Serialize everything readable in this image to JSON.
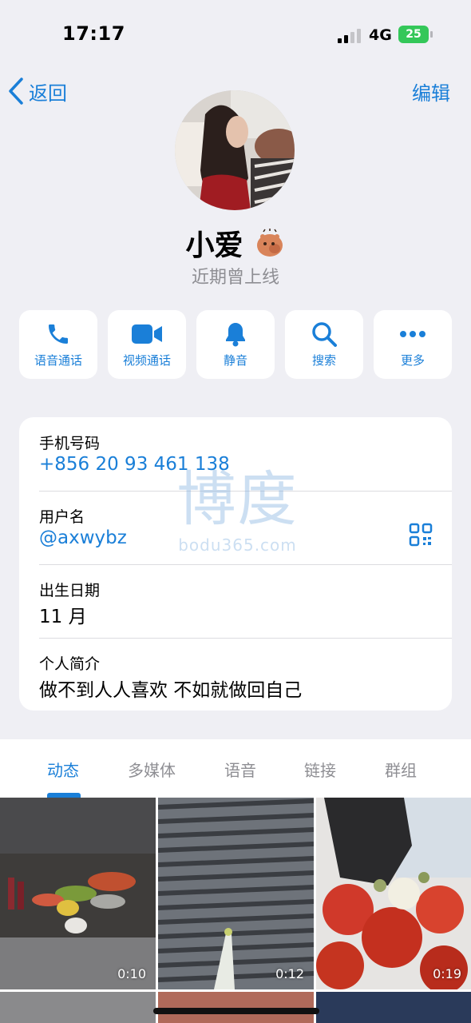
{
  "status_bar": {
    "time": "17:17",
    "network": "4G",
    "battery": "25",
    "signal_bars_filled": 2,
    "signal_bars_total": 4
  },
  "nav": {
    "back_label": "返回",
    "edit_label": "编辑"
  },
  "profile": {
    "name": "小爱",
    "status": "近期曾上线"
  },
  "actions": [
    {
      "label": "语音通话",
      "icon": "phone-icon"
    },
    {
      "label": "视频通话",
      "icon": "video-camera-icon"
    },
    {
      "label": "静音",
      "icon": "bell-icon"
    },
    {
      "label": "搜索",
      "icon": "search-icon"
    },
    {
      "label": "更多",
      "icon": "more-icon"
    }
  ],
  "info": {
    "phone_label": "手机号码",
    "phone_value": "+856 20 93 461 138",
    "username_label": "用户名",
    "username_value": "@axwybz",
    "birthday_label": "出生日期",
    "birthday_value": "11 月",
    "bio_label": "个人简介",
    "bio_value": "做不到人人喜欢 不如就做回自己"
  },
  "watermark": {
    "big": "博度",
    "small": "bodu365.com"
  },
  "tabs": [
    {
      "label": "动态",
      "active": true
    },
    {
      "label": "多媒体",
      "active": false
    },
    {
      "label": "语音",
      "active": false
    },
    {
      "label": "链接",
      "active": false
    },
    {
      "label": "群组",
      "active": false
    }
  ],
  "media": [
    {
      "duration": "0:10"
    },
    {
      "duration": "0:12"
    },
    {
      "duration": "0:19"
    }
  ],
  "colors": {
    "accent": "#1a7fd8",
    "background": "#efeff4",
    "battery": "#34c759"
  }
}
